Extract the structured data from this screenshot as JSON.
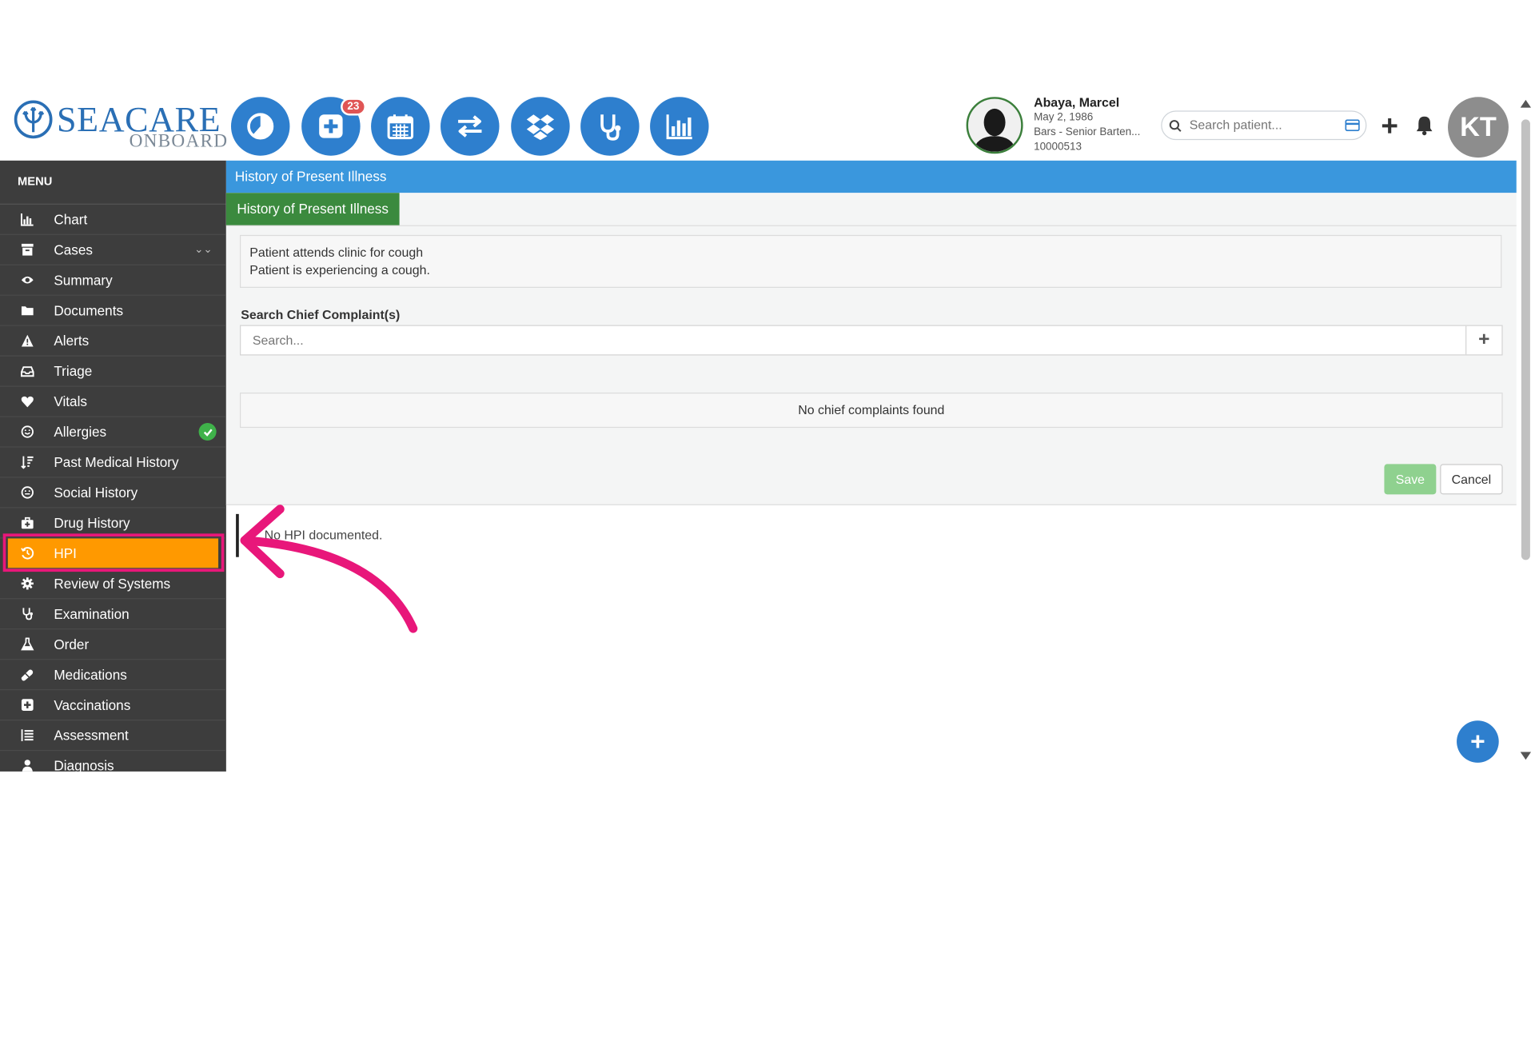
{
  "header": {
    "logo_text": "SEACARE",
    "logo_subtext": "ONBOARD",
    "notification_badge": "23",
    "icons": [
      "pie-chart-icon",
      "medical-plus-icon",
      "calendar-icon",
      "transfer-icon",
      "dropbox-icon",
      "stethoscope-icon",
      "bar-chart-icon"
    ],
    "patient": {
      "name": "Abaya, Marcel",
      "dob": "May 2, 1986",
      "role": "Bars - Senior Barten...",
      "id": "10000513"
    },
    "search_placeholder": "Search patient...",
    "user_initials": "KT"
  },
  "sidebar": {
    "title": "MENU",
    "items": [
      {
        "label": "Chart",
        "icon": "bar-chart-icon"
      },
      {
        "label": "Cases",
        "icon": "archive-icon"
      },
      {
        "label": "Summary",
        "icon": "eye-icon"
      },
      {
        "label": "Documents",
        "icon": "folder-icon"
      },
      {
        "label": "Alerts",
        "icon": "warning-icon"
      },
      {
        "label": "Triage",
        "icon": "inbox-icon"
      },
      {
        "label": "Vitals",
        "icon": "heart-icon"
      },
      {
        "label": "Allergies",
        "icon": "face-icon"
      },
      {
        "label": "Past Medical History",
        "icon": "sort-icon"
      },
      {
        "label": "Social History",
        "icon": "face-icon"
      },
      {
        "label": "Drug History",
        "icon": "medkit-icon"
      },
      {
        "label": "HPI",
        "icon": "history-icon"
      },
      {
        "label": "Review of Systems",
        "icon": "gear-icon"
      },
      {
        "label": "Examination",
        "icon": "stethoscope-icon"
      },
      {
        "label": "Order",
        "icon": "flask-icon"
      },
      {
        "label": "Medications",
        "icon": "pill-icon"
      },
      {
        "label": "Vaccinations",
        "icon": "plus-square-icon"
      },
      {
        "label": "Assessment",
        "icon": "list-icon"
      },
      {
        "label": "Diagnosis",
        "icon": "user-md-icon"
      }
    ],
    "active_item": "HPI"
  },
  "main": {
    "section_title": "History of Present Illness",
    "tab_label": "History of Present Illness",
    "hpi_lines": [
      "Patient attends clinic for cough",
      "Patient is experiencing a cough."
    ],
    "cc_label": "Search Chief Complaint(s)",
    "cc_placeholder": "Search...",
    "cc_add": "+",
    "no_cc_text": "No chief complaints found",
    "save_label": "Save",
    "cancel_label": "Cancel",
    "no_hpi_text": "No HPI documented."
  },
  "fab_label": "+",
  "colors": {
    "brand_blue": "#2e7fce",
    "topbar_blue": "#3a97dd",
    "tab_green": "#3b8a3e",
    "active_orange": "#ff9900",
    "highlight_pink": "#e8177a",
    "sidebar_bg": "#3d3d3d",
    "save_green": "#8fd18f"
  }
}
